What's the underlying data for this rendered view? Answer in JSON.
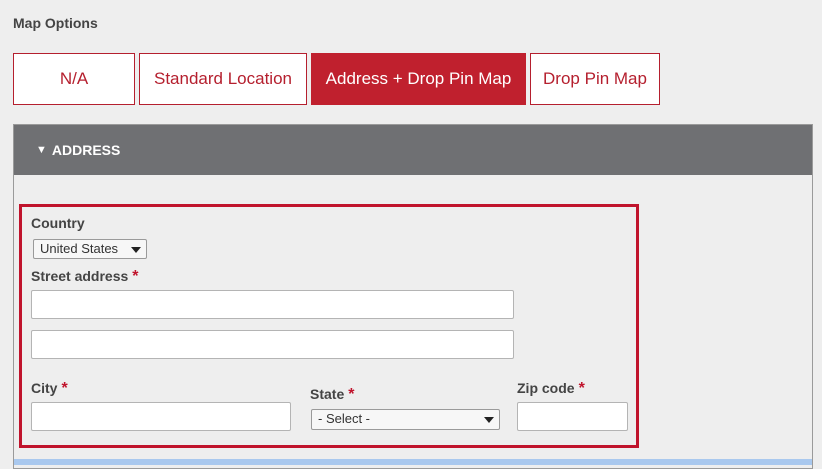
{
  "map_options": {
    "label": "Map Options",
    "options": [
      {
        "label": "N/A"
      },
      {
        "label": "Standard Location"
      },
      {
        "label": "Address + Drop Pin Map"
      },
      {
        "label": "Drop Pin Map"
      }
    ],
    "selected": "Address + Drop Pin Map"
  },
  "address_panel": {
    "header": "ADDRESS",
    "toggle_icon": "triangle-down-icon",
    "country": {
      "label": "Country",
      "value": "United States"
    },
    "street": {
      "label": "Street address",
      "required": "*",
      "line1": "",
      "line2": ""
    },
    "city": {
      "label": "City",
      "required": "*",
      "value": ""
    },
    "state": {
      "label": "State",
      "required": "*",
      "value": "- Select -"
    },
    "zip": {
      "label": "Zip code",
      "required": "*",
      "value": ""
    }
  },
  "colors": {
    "accent": "#c0202e",
    "header_bg": "#6f7073",
    "highlight_border": "#c0132c",
    "page_bg": "#eeeeee"
  }
}
